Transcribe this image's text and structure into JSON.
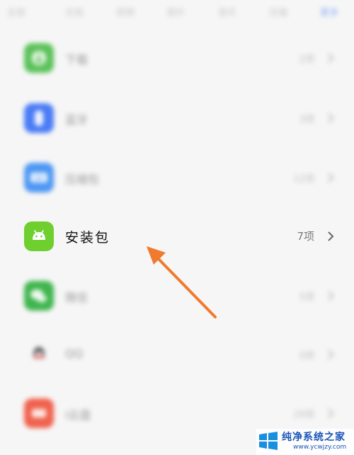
{
  "tabs": [
    {
      "label": "全部"
    },
    {
      "label": "文档"
    },
    {
      "label": "视频"
    },
    {
      "label": "图片"
    },
    {
      "label": "音乐"
    },
    {
      "label": "压缩"
    },
    {
      "label": "更多"
    }
  ],
  "categories": [
    {
      "label": "下载",
      "count": "2项",
      "icon_color": "#5cc25a",
      "icon": "download-icon"
    },
    {
      "label": "蓝牙",
      "count": "3项",
      "icon_color": "#4a7cf5",
      "icon": "bluetooth-icon"
    },
    {
      "label": "压缩包",
      "count": "12项",
      "icon_color": "#4d97f3",
      "icon": "zip-icon"
    },
    {
      "label": "安装包",
      "count": "7项",
      "icon_color": "#6fcf2e",
      "icon": "android-icon"
    },
    {
      "label": "微信",
      "count": "5项",
      "icon_color": "#3fb54d",
      "icon": "wechat-icon"
    },
    {
      "label": "QQ",
      "count": "0项",
      "icon_color": "#e8e8e8",
      "icon": "qq-icon"
    },
    {
      "label": "i云盘",
      "count": "29项",
      "icon_color": "#f0624e",
      "icon": "cloud-icon"
    }
  ],
  "annotation": {
    "arrow_color": "#f07a2e"
  },
  "watermark": {
    "title": "纯净系统之家",
    "url": "www.ycwjzy.com"
  }
}
